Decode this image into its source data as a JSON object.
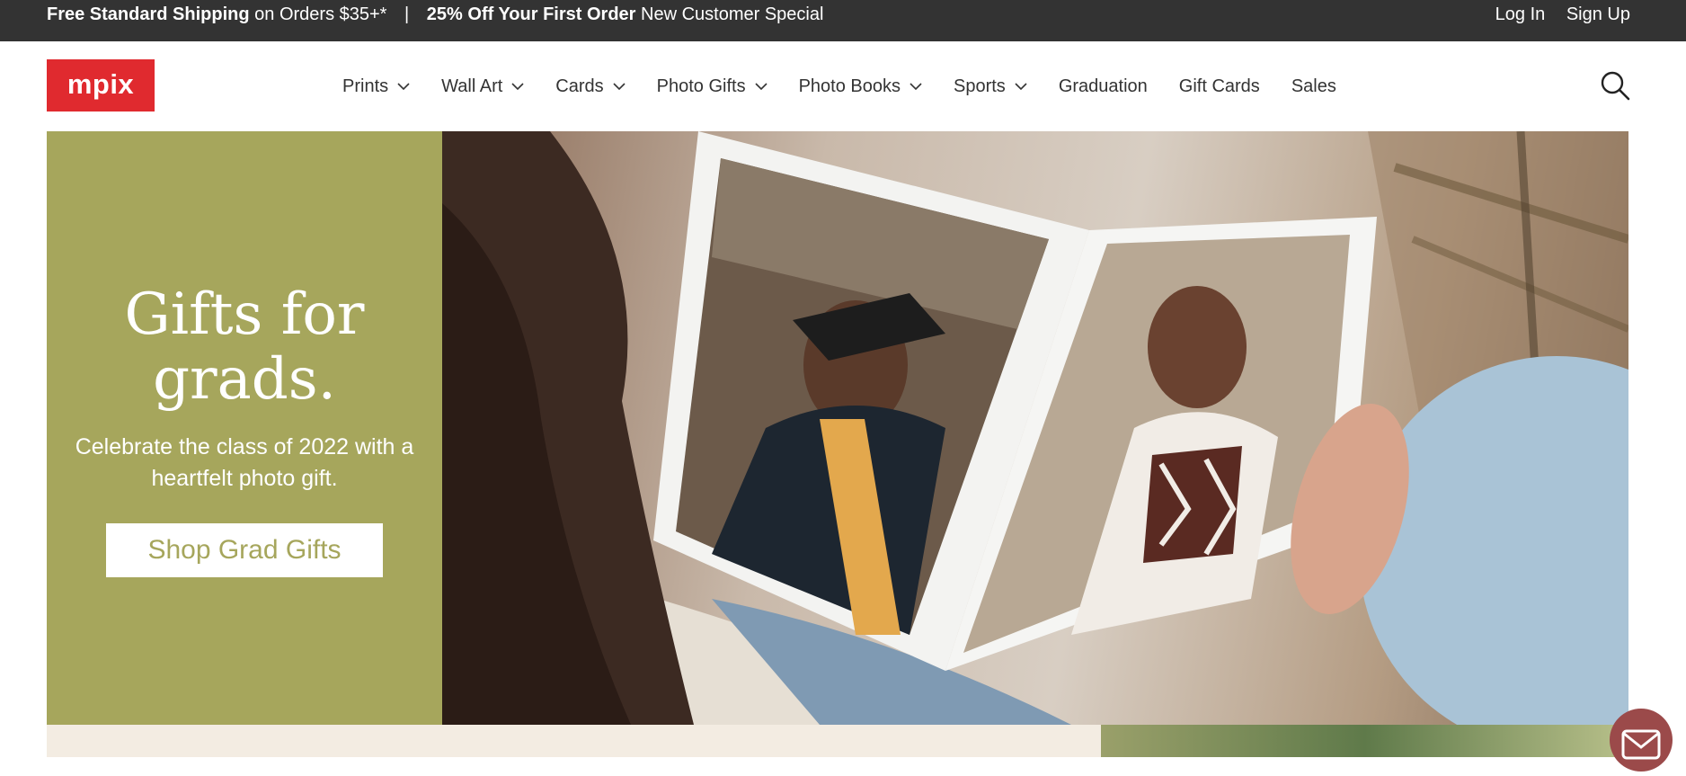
{
  "topbar": {
    "promo1_bold": "Free Standard Shipping",
    "promo1_rest": "on Orders $35+*",
    "separator": "|",
    "promo2_bold": "25% Off Your First Order",
    "promo2_rest": "New Customer Special",
    "login": "Log In",
    "signup": "Sign Up"
  },
  "header": {
    "logo": "mpix",
    "nav": [
      {
        "label": "Prints",
        "dropdown": true
      },
      {
        "label": "Wall Art",
        "dropdown": true
      },
      {
        "label": "Cards",
        "dropdown": true
      },
      {
        "label": "Photo Gifts",
        "dropdown": true
      },
      {
        "label": "Photo Books",
        "dropdown": true
      },
      {
        "label": "Sports",
        "dropdown": true
      },
      {
        "label": "Graduation",
        "dropdown": false
      },
      {
        "label": "Gift Cards",
        "dropdown": false
      },
      {
        "label": "Sales",
        "dropdown": false
      }
    ],
    "search_icon": "search-icon"
  },
  "hero": {
    "title_line1": "Gifts for",
    "title_line2": "grads.",
    "subtitle": "Celebrate the class of 2022 with a heartfelt photo gift.",
    "cta": "Shop Grad Gifts"
  },
  "colors": {
    "topbar_bg": "#333333",
    "logo_red": "#e02a2f",
    "hero_olive": "#a6a65c",
    "chat_button": "#9b4a4a"
  },
  "chat_icon": "mail-icon"
}
